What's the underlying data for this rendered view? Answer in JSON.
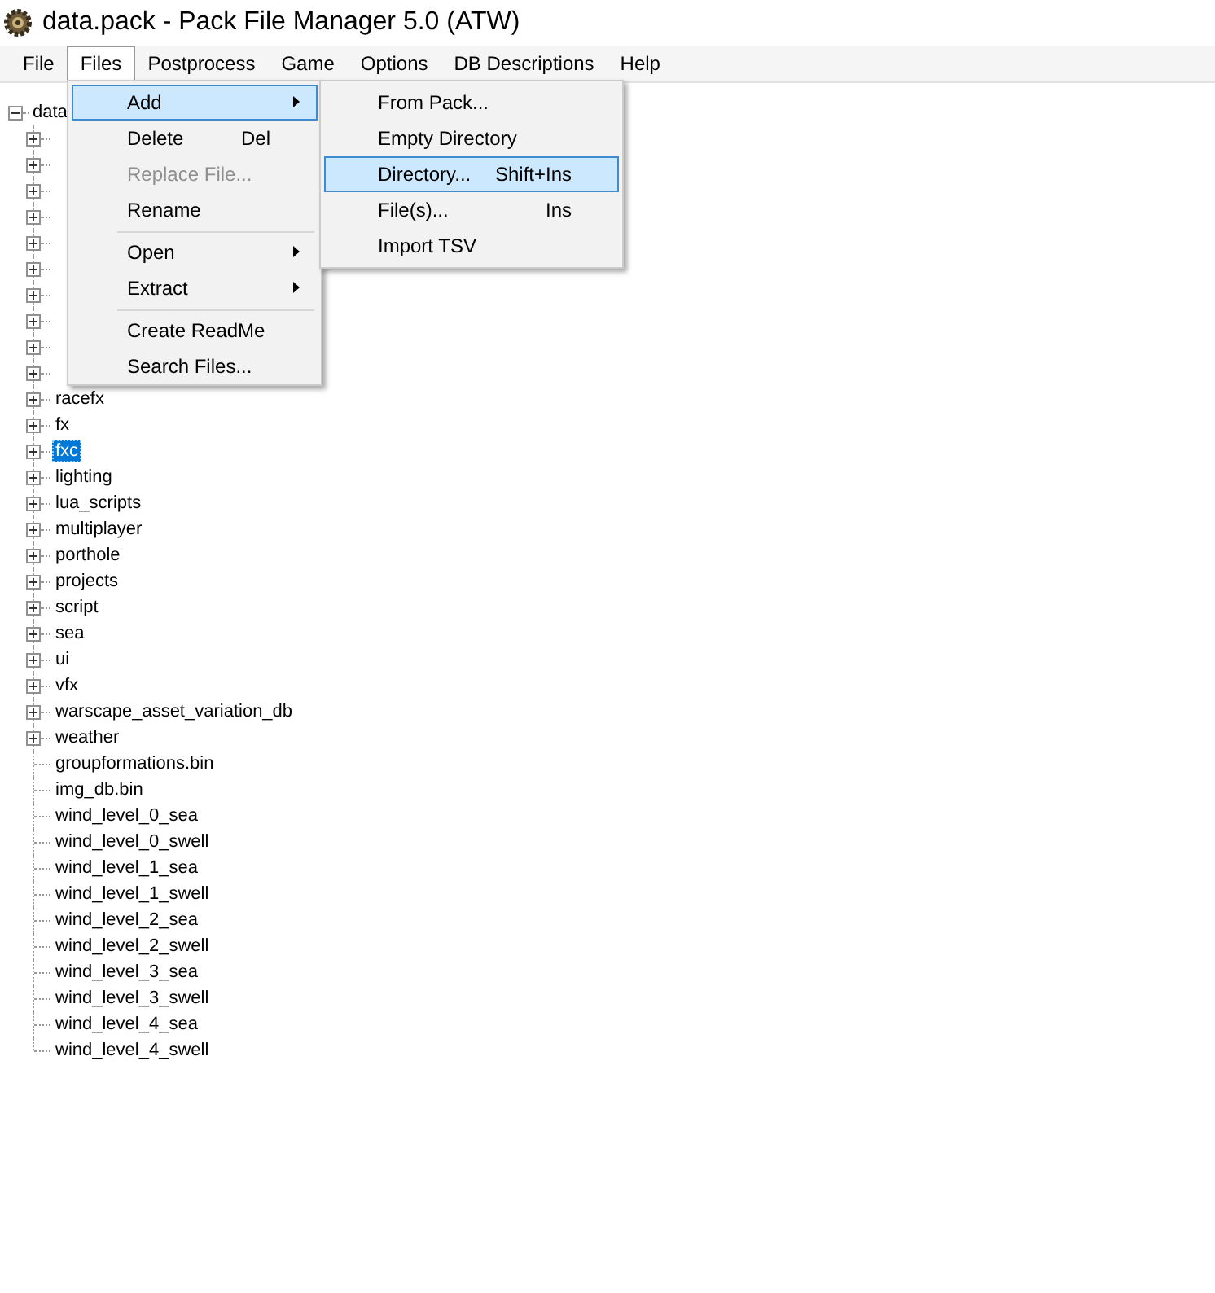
{
  "window": {
    "title": "data.pack - Pack File Manager 5.0 (ATW)"
  },
  "menu_bar": [
    {
      "label": "File",
      "selected": false
    },
    {
      "label": "Files",
      "selected": true
    },
    {
      "label": "Postprocess",
      "selected": false
    },
    {
      "label": "Game",
      "selected": false
    },
    {
      "label": "Options",
      "selected": false
    },
    {
      "label": "DB Descriptions",
      "selected": false
    },
    {
      "label": "Help",
      "selected": false
    }
  ],
  "files_menu": [
    {
      "kind": "item",
      "label": "Add",
      "submenu": true,
      "selected": true,
      "disabled": false
    },
    {
      "kind": "item",
      "label": "Delete",
      "shortcut": "Del",
      "submenu": false,
      "selected": false,
      "disabled": false
    },
    {
      "kind": "item",
      "label": "Replace File...",
      "submenu": false,
      "selected": false,
      "disabled": true
    },
    {
      "kind": "item",
      "label": "Rename",
      "submenu": false,
      "selected": false,
      "disabled": false
    },
    {
      "kind": "separator"
    },
    {
      "kind": "item",
      "label": "Open",
      "submenu": true,
      "selected": false,
      "disabled": false
    },
    {
      "kind": "item",
      "label": "Extract",
      "submenu": true,
      "selected": false,
      "disabled": false
    },
    {
      "kind": "separator"
    },
    {
      "kind": "item",
      "label": "Create ReadMe",
      "submenu": false,
      "selected": false,
      "disabled": false
    },
    {
      "kind": "item",
      "label": "Search Files...",
      "submenu": false,
      "selected": false,
      "disabled": false
    }
  ],
  "add_submenu": [
    {
      "kind": "item",
      "label": "From Pack...",
      "selected": false
    },
    {
      "kind": "item",
      "label": "Empty Directory",
      "selected": false
    },
    {
      "kind": "item",
      "label": "Directory...",
      "shortcut": "Shift+Ins",
      "selected": true
    },
    {
      "kind": "item",
      "label": "File(s)...",
      "shortcut": "Ins",
      "selected": false
    },
    {
      "kind": "item",
      "label": "Import TSV",
      "selected": false
    }
  ],
  "tree": {
    "label": "data",
    "expanded": true,
    "selected": false,
    "children": [
      {
        "kind": "folder",
        "expanded": false
      },
      {
        "kind": "folder",
        "expanded": false
      },
      {
        "kind": "folder",
        "expanded": false
      },
      {
        "kind": "folder",
        "expanded": false
      },
      {
        "kind": "folder",
        "expanded": false
      },
      {
        "kind": "folder",
        "expanded": false
      },
      {
        "kind": "folder",
        "expanded": false
      },
      {
        "kind": "folder",
        "expanded": false
      },
      {
        "kind": "folder",
        "expanded": false
      },
      {
        "kind": "folder",
        "expanded": false
      },
      {
        "kind": "folder",
        "label": "racefx",
        "expanded": false,
        "selected": false
      },
      {
        "kind": "folder",
        "label": "fx",
        "expanded": false,
        "selected": false
      },
      {
        "kind": "folder",
        "label": "fxc",
        "expanded": false,
        "selected": true
      },
      {
        "kind": "folder",
        "label": "lighting",
        "expanded": false,
        "selected": false
      },
      {
        "kind": "folder",
        "label": "lua_scripts",
        "expanded": false,
        "selected": false
      },
      {
        "kind": "folder",
        "label": "multiplayer",
        "expanded": false,
        "selected": false
      },
      {
        "kind": "folder",
        "label": "porthole",
        "expanded": false,
        "selected": false
      },
      {
        "kind": "folder",
        "label": "projects",
        "expanded": false,
        "selected": false
      },
      {
        "kind": "folder",
        "label": "script",
        "expanded": false,
        "selected": false
      },
      {
        "kind": "folder",
        "label": "sea",
        "expanded": false,
        "selected": false
      },
      {
        "kind": "folder",
        "label": "ui",
        "expanded": false,
        "selected": false
      },
      {
        "kind": "folder",
        "label": "vfx",
        "expanded": false,
        "selected": false
      },
      {
        "kind": "folder",
        "label": "warscape_asset_variation_db",
        "expanded": false,
        "selected": false
      },
      {
        "kind": "folder",
        "label": "weather",
        "expanded": false,
        "selected": false
      },
      {
        "kind": "file",
        "label": "groupformations.bin",
        "selected": false
      },
      {
        "kind": "file",
        "label": "img_db.bin",
        "selected": false
      },
      {
        "kind": "file",
        "label": "wind_level_0_sea",
        "selected": false
      },
      {
        "kind": "file",
        "label": "wind_level_0_swell",
        "selected": false
      },
      {
        "kind": "file",
        "label": "wind_level_1_sea",
        "selected": false
      },
      {
        "kind": "file",
        "label": "wind_level_1_swell",
        "selected": false
      },
      {
        "kind": "file",
        "label": "wind_level_2_sea",
        "selected": false
      },
      {
        "kind": "file",
        "label": "wind_level_2_swell",
        "selected": false
      },
      {
        "kind": "file",
        "label": "wind_level_3_sea",
        "selected": false
      },
      {
        "kind": "file",
        "label": "wind_level_3_swell",
        "selected": false
      },
      {
        "kind": "file",
        "label": "wind_level_4_sea",
        "selected": false
      },
      {
        "kind": "file",
        "label": "wind_level_4_swell",
        "selected": false
      }
    ]
  }
}
